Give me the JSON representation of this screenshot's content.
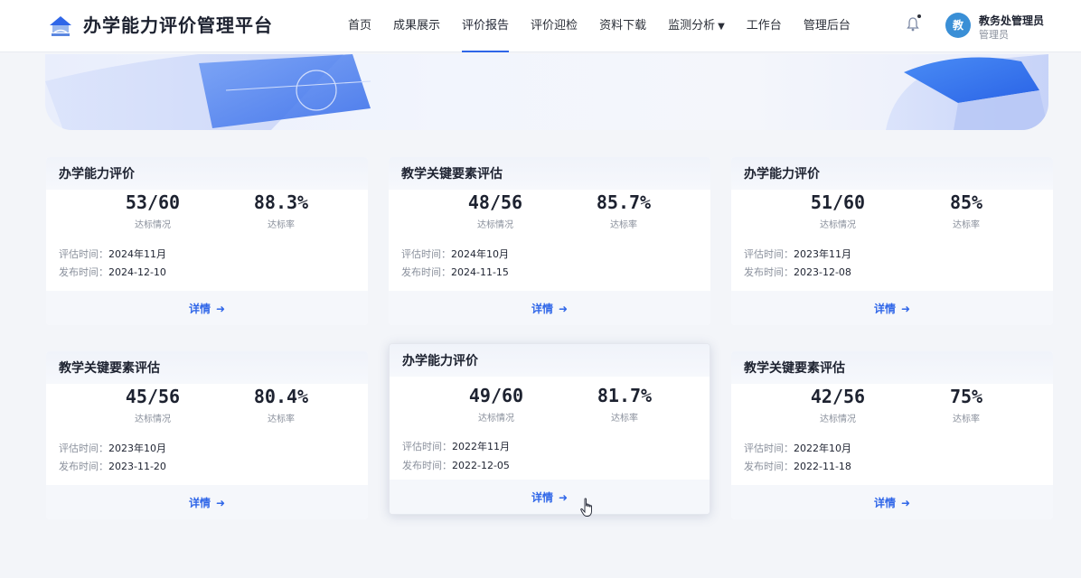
{
  "header": {
    "app_title": "办学能力评价管理平台",
    "nav": [
      {
        "label": "首页",
        "active": false
      },
      {
        "label": "成果展示",
        "active": false
      },
      {
        "label": "评价报告",
        "active": true
      },
      {
        "label": "评价迎检",
        "active": false
      },
      {
        "label": "资料下载",
        "active": false
      },
      {
        "label": "监测分析",
        "active": false,
        "dropdown": true
      },
      {
        "label": "工作台",
        "active": false
      },
      {
        "label": "管理后台",
        "active": false
      }
    ],
    "dropdown_caret": "▼",
    "user": {
      "avatar_text": "教",
      "name": "教务处管理员",
      "role": "管理员"
    }
  },
  "labels": {
    "standard_status": "达标情况",
    "standard_rate": "达标率",
    "eval_time": "评估时间：",
    "publish_time": "发布时间：",
    "detail": "详情",
    "detail_arrow": "➜"
  },
  "cards": [
    {
      "title": "办学能力评价",
      "ratio": "53/60",
      "rate": "88.3%",
      "eval_time": "2024年11月",
      "publish_time": "2024-12-10"
    },
    {
      "title": "教学关键要素评估",
      "ratio": "48/56",
      "rate": "85.7%",
      "eval_time": "2024年10月",
      "publish_time": "2024-11-15"
    },
    {
      "title": "办学能力评价",
      "ratio": "51/60",
      "rate": "85%",
      "eval_time": "2023年11月",
      "publish_time": "2023-12-08"
    },
    {
      "title": "教学关键要素评估",
      "ratio": "45/56",
      "rate": "80.4%",
      "eval_time": "2023年10月",
      "publish_time": "2023-11-20"
    },
    {
      "title": "办学能力评价",
      "ratio": "49/60",
      "rate": "81.7%",
      "eval_time": "2022年11月",
      "publish_time": "2022-12-05"
    },
    {
      "title": "教学关键要素评估",
      "ratio": "42/56",
      "rate": "75%",
      "eval_time": "2022年10月",
      "publish_time": "2022-11-18"
    }
  ],
  "colors": {
    "accent": "#2f66e8",
    "avatar_bg": "#3a8fd6"
  }
}
